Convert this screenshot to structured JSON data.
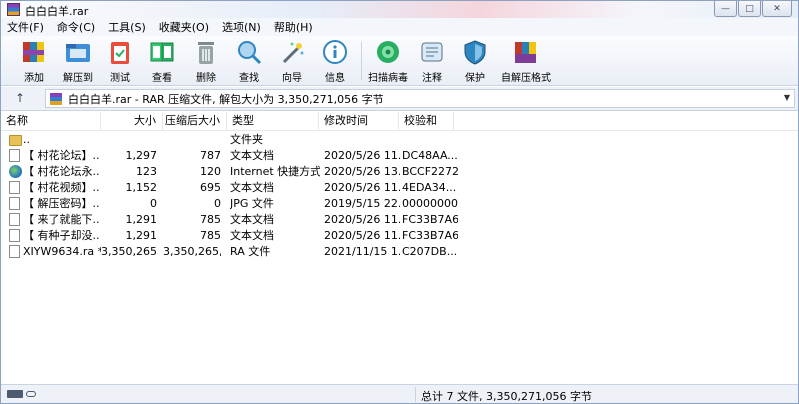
{
  "window": {
    "title": "白白白羊.rar",
    "controls": {
      "minimize": "—",
      "maximize": "□",
      "close": "✕"
    }
  },
  "menu": [
    "文件(F)",
    "命令(C)",
    "工具(S)",
    "收藏夹(O)",
    "选项(N)",
    "帮助(H)"
  ],
  "toolbar": [
    {
      "label": "添加",
      "icon": "books-add-icon"
    },
    {
      "label": "解压到",
      "icon": "folder-extract-icon"
    },
    {
      "label": "测试",
      "icon": "clipboard-test-icon"
    },
    {
      "label": "查看",
      "icon": "book-view-icon"
    },
    {
      "label": "删除",
      "icon": "trash-icon"
    },
    {
      "label": "查找",
      "icon": "magnifier-icon"
    },
    {
      "label": "向导",
      "icon": "wand-icon"
    },
    {
      "label": "信息",
      "icon": "info-icon"
    },
    {
      "label": "扫描病毒",
      "icon": "virus-scan-icon"
    },
    {
      "label": "注释",
      "icon": "comment-icon"
    },
    {
      "label": "保护",
      "icon": "shield-icon"
    },
    {
      "label": "自解压格式",
      "icon": "sfx-icon"
    }
  ],
  "address": {
    "text": "白白白羊.rar - RAR 压缩文件, 解包大小为 3,350,271,056 字节"
  },
  "columns": {
    "name": "名称",
    "size": "大小",
    "packed": "压缩后大小",
    "type": "类型",
    "modified": "修改时间",
    "crc": "校验和"
  },
  "files": [
    {
      "name": "..",
      "size": "",
      "packed": "",
      "type": "文件夹",
      "modified": "",
      "crc": "",
      "icon": "folder"
    },
    {
      "name": "【 村花论坛】...",
      "size": "1,297",
      "packed": "787",
      "type": "文本文档",
      "modified": "2020/5/26 11...",
      "crc": "DC48AA...",
      "icon": "doc"
    },
    {
      "name": "【 村花论坛永...",
      "size": "123",
      "packed": "120",
      "type": "Internet 快捷方式",
      "modified": "2020/5/26 13...",
      "crc": "BCCF2272",
      "icon": "globe"
    },
    {
      "name": "【 村花视频】...",
      "size": "1,152",
      "packed": "695",
      "type": "文本文档",
      "modified": "2020/5/26 11...",
      "crc": "4EDA34...",
      "icon": "doc"
    },
    {
      "name": "【 解压密码】...",
      "size": "0",
      "packed": "0",
      "type": "JPG 文件",
      "modified": "2019/5/15 22...",
      "crc": "00000000",
      "icon": "doc"
    },
    {
      "name": "【 来了就能下...",
      "size": "1,291",
      "packed": "785",
      "type": "文本文档",
      "modified": "2020/5/26 11...",
      "crc": "FC33B7A6",
      "icon": "doc"
    },
    {
      "name": "【 有种子却没...",
      "size": "1,291",
      "packed": "785",
      "type": "文本文档",
      "modified": "2020/5/26 11...",
      "crc": "FC33B7A6",
      "icon": "doc"
    },
    {
      "name": "XIYW9634.ra *",
      "size": "3,350,265,...",
      "packed": "3,350,265,...",
      "type": "RA 文件",
      "modified": "2021/11/15 1...",
      "crc": "C207DB...",
      "icon": "doc"
    }
  ],
  "status": {
    "summary": "总计 7 文件, 3,350,271,056 字节"
  }
}
